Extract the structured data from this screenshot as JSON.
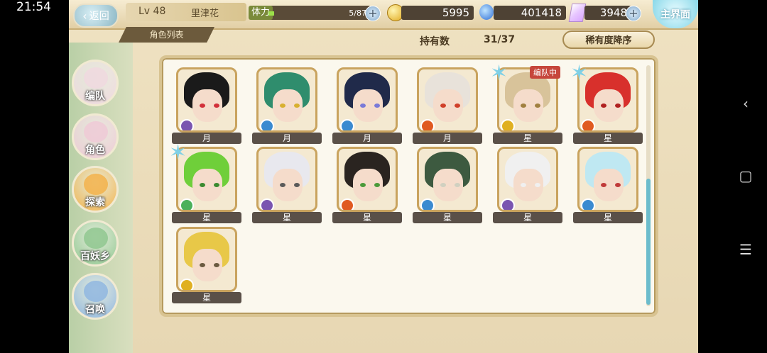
{
  "status_bar": {
    "time": "21:54"
  },
  "nav": {
    "back": "‹",
    "home": "▢",
    "menu": "☰"
  },
  "header": {
    "back_label": "返回",
    "level": "Lv 48",
    "player_name": "里津花",
    "stamina_label": "体力",
    "stamina_value": "5/87",
    "stamina_fraction": 0.057,
    "gold": "5995",
    "water": "401418",
    "gems": "3948",
    "home_label": "主界面"
  },
  "subheader": {
    "title": "角色列表",
    "owned_label": "持有数",
    "owned_value": "31/37",
    "sort_label": "稀有度降序"
  },
  "left_menu": [
    {
      "label": "编队",
      "color": "#f0d8df"
    },
    {
      "label": "角色",
      "color": "#efc9d6"
    },
    {
      "label": "探索",
      "color": "#f3b24a"
    },
    {
      "label": "百妖乡",
      "color": "#8fc78f"
    },
    {
      "label": "召唤",
      "color": "#8fb6e0"
    }
  ],
  "cards": [
    {
      "rank": "月",
      "hair": "#1a1a1a",
      "eye": "#d2303a",
      "elem": "#7a55b0",
      "star": "",
      "badge": ""
    },
    {
      "rank": "月",
      "hair": "#2f8d6d",
      "eye": "#d8b030",
      "elem": "#3a8ad0",
      "star": "",
      "badge": ""
    },
    {
      "rank": "月",
      "hair": "#202a4a",
      "eye": "#7a7ad8",
      "elem": "#3a8ad0",
      "star": "",
      "badge": ""
    },
    {
      "rank": "月",
      "hair": "#e8e2da",
      "eye": "#d0402a",
      "elem": "#e05a20",
      "star": "",
      "badge": ""
    },
    {
      "rank": "星",
      "hair": "#d8c39a",
      "eye": "#a08040",
      "elem": "#e0b020",
      "star": "✶",
      "badge": "编队中"
    },
    {
      "rank": "星",
      "hair": "#d8302c",
      "eye": "#b02020",
      "elem": "#e05a20",
      "star": "✶",
      "badge": ""
    },
    {
      "rank": "星",
      "hair": "#6fcf3a",
      "eye": "#3a8a30",
      "elem": "#4ab05a",
      "star": "✶",
      "badge": ""
    },
    {
      "rank": "星",
      "hair": "#e8e8ee",
      "eye": "#5a5a5a",
      "elem": "#7a55b0",
      "star": "",
      "badge": ""
    },
    {
      "rank": "星",
      "hair": "#2a2420",
      "eye": "#4a9a3a",
      "elem": "#e05a20",
      "star": "",
      "badge": ""
    },
    {
      "rank": "星",
      "hair": "#3d5a40",
      "eye": "#d0d0c0",
      "elem": "#3a8ad0",
      "star": "",
      "badge": ""
    },
    {
      "rank": "星",
      "hair": "#f0f0f0",
      "eye": "#f0f0f0",
      "elem": "#7a55b0",
      "star": "",
      "badge": ""
    },
    {
      "rank": "星",
      "hair": "#bfe8f2",
      "eye": "#c03a3a",
      "elem": "#3a8ad0",
      "star": "",
      "badge": ""
    },
    {
      "rank": "星",
      "hair": "#e8c848",
      "eye": "#6a5a40",
      "elem": "#e0b020",
      "star": "",
      "badge": ""
    }
  ]
}
